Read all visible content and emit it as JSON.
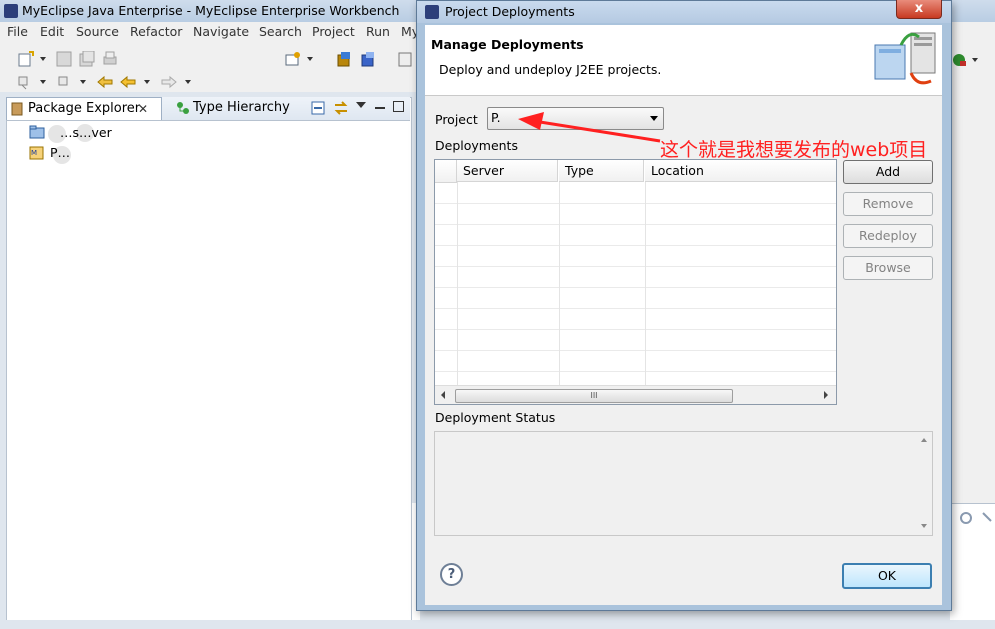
{
  "window": {
    "title": "MyEclipse Java Enterprise - MyEclipse Enterprise Workbench"
  },
  "menu": [
    "File",
    "Edit",
    "Source",
    "Refactor",
    "Navigate",
    "Search",
    "Project",
    "Run",
    "My"
  ],
  "views": {
    "package_explorer_tab": "Package Explorer",
    "type_hierarchy_tab": "Type Hierarchy",
    "tree": [
      {
        "label": "Servers"
      },
      {
        "label": "P"
      }
    ],
    "tree_visible": [
      "…s…ver",
      "P…"
    ]
  },
  "dialog": {
    "title": "Project Deployments",
    "header_title": "Manage Deployments",
    "header_desc": "Deploy and undeploy J2EE projects.",
    "project_label": "Project",
    "project_value": "P.",
    "deployments_label": "Deployments",
    "columns": [
      "Server",
      "Type",
      "Location"
    ],
    "buttons": {
      "add": "Add",
      "remove": "Remove",
      "redeploy": "Redeploy",
      "browse": "Browse"
    },
    "status_label": "Deployment Status",
    "ok": "OK",
    "help": "?",
    "close": "x",
    "scroll_grip": "III"
  },
  "annotation": {
    "text": "这个就是我想要发布的web项目",
    "color": "#ff2020"
  }
}
